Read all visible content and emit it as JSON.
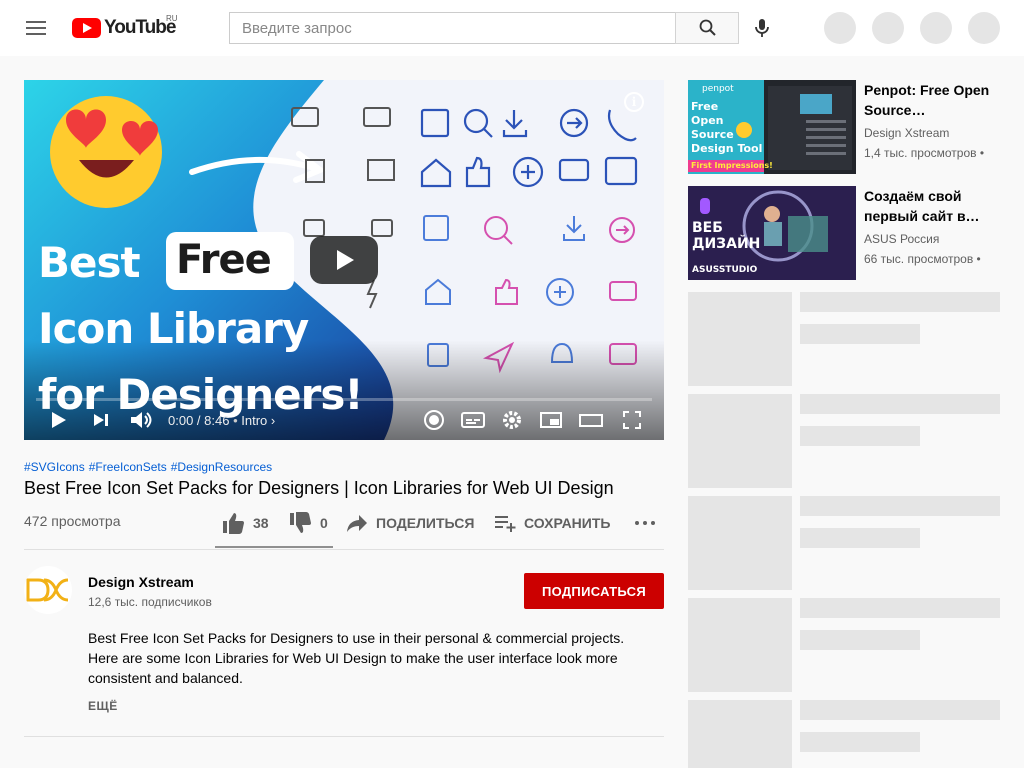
{
  "header": {
    "logo_text": "YouTube",
    "country_code": "RU",
    "search_placeholder": "Введите запрос",
    "icons": [
      "menu-icon",
      "search-icon",
      "mic-icon"
    ]
  },
  "video": {
    "thumbnail": {
      "line1_a": "Best",
      "line1_b": "Free",
      "line2": "Icon Library",
      "line3": "for Designers!"
    },
    "time": "0:00 / 8:46",
    "chapter": "Intro",
    "tags": [
      "#SVGIcons",
      "#FreeIconSets",
      "#DesignResources"
    ],
    "title": "Best Free Icon Set Packs for Designers | Icon Libraries for Web UI Design",
    "views": "472 просмотра",
    "likes": "38",
    "dislikes": "0",
    "share_label": "ПОДЕЛИТЬСЯ",
    "save_label": "СОХРАНИТЬ"
  },
  "channel": {
    "name": "Design Xstream",
    "subscribers": "12,6 тыс. подписчиков",
    "subscribe_label": "ПОДПИСАТЬСЯ"
  },
  "description": {
    "text": "Best Free Icon Set Packs for Designers to use in their personal & commercial projects. Here are some Icon Libraries for Web UI Design to make the user interface look more consistent and balanced.",
    "more_label": "ЕЩЁ"
  },
  "recommendations": [
    {
      "title": "Penpot: Free Open Source…",
      "channel": "Design Xstream",
      "views": "1,4 тыс. просмотров •",
      "thumb_brand": "penpot",
      "thumb_text": [
        "Free",
        "Open",
        "Source",
        "Design Tool"
      ],
      "thumb_strip": "First Impressions!"
    },
    {
      "title": "Создаём свой первый сайт в…",
      "channel": "ASUS Россия",
      "views": "66 тыс. просмотров •",
      "thumb_text": [
        "ВЕБ",
        "ДИЗАЙН"
      ],
      "thumb_brand": "ASUSSTUDIO"
    }
  ],
  "colors": {
    "accent_red": "#cc0000",
    "link_blue": "#065fd4",
    "skeleton": "#e5e5e5"
  }
}
